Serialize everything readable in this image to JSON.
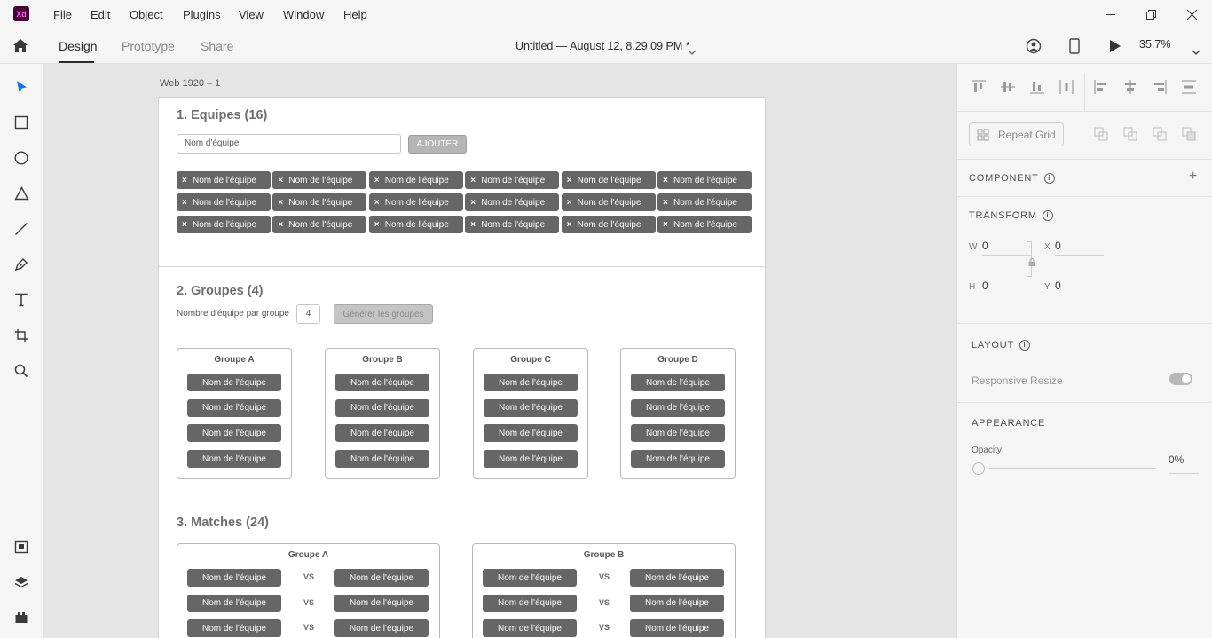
{
  "app": {
    "logo": "Xd",
    "menu": [
      "File",
      "Edit",
      "Object",
      "Plugins",
      "View",
      "Window",
      "Help"
    ],
    "window_controls": [
      "minimize-icon",
      "restore-icon",
      "close-icon"
    ]
  },
  "topbar": {
    "tabs": [
      "Design",
      "Prototype",
      "Share"
    ],
    "active_tab": "Design",
    "doc_title": "Untitled — August 12, 8.29.09 PM *",
    "zoom": "35.7%"
  },
  "tools": [
    "select-icon",
    "rectangle-icon",
    "ellipse-icon",
    "polygon-icon",
    "line-icon",
    "pen-icon",
    "text-icon",
    "artboard-icon",
    "zoom-icon"
  ],
  "bottom_tools": [
    "assets-icon",
    "layers-icon",
    "plugins-icon"
  ],
  "artboard": {
    "label": "Web 1920 – 1",
    "section1": {
      "title": "1. Equipes (16)",
      "input_placeholder": "Nom d'équipe",
      "add_button": "AJOUTER",
      "chip_label": "Nom de l'équipe",
      "chip_x": "×"
    },
    "section2": {
      "title": "2. Groupes (4)",
      "per_group_label": "Nombre d'équipe par groupe",
      "per_group_value": "4",
      "generate_button": "Générer les groupes",
      "groups": [
        {
          "name": "Groupe A",
          "teams": [
            "Nom de l'équipe",
            "Nom de l'équipe",
            "Nom de l'équipe",
            "Nom de l'équipe"
          ]
        },
        {
          "name": "Groupe B",
          "teams": [
            "Nom de l'équipe",
            "Nom de l'équipe",
            "Nom de l'équipe",
            "Nom de l'équipe"
          ]
        },
        {
          "name": "Groupe C",
          "teams": [
            "Nom de l'équipe",
            "Nom de l'équipe",
            "Nom de l'équipe",
            "Nom de l'équipe"
          ]
        },
        {
          "name": "Groupe D",
          "teams": [
            "Nom de l'équipe",
            "Nom de l'équipe",
            "Nom de l'équipe",
            "Nom de l'équipe"
          ]
        }
      ]
    },
    "section3": {
      "title": "3. Matches (24)",
      "vs": "VS",
      "match_groups": [
        {
          "name": "Groupe A",
          "team": "Nom de l'équipe"
        },
        {
          "name": "Groupe B",
          "team": "Nom de l'équipe"
        }
      ]
    }
  },
  "panel": {
    "repeat_grid": "Repeat Grid",
    "component": "COMPONENT",
    "component_add": "+",
    "transform": "TRANSFORM",
    "w_label": "W",
    "w": "0",
    "x_label": "X",
    "x": "0",
    "h_label": "H",
    "h": "0",
    "y_label": "Y",
    "y": "0",
    "layout": "LAYOUT",
    "responsive_resize": "Responsive Resize",
    "appearance": "APPEARANCE",
    "opacity_label": "Opacity",
    "opacity": "0%"
  }
}
